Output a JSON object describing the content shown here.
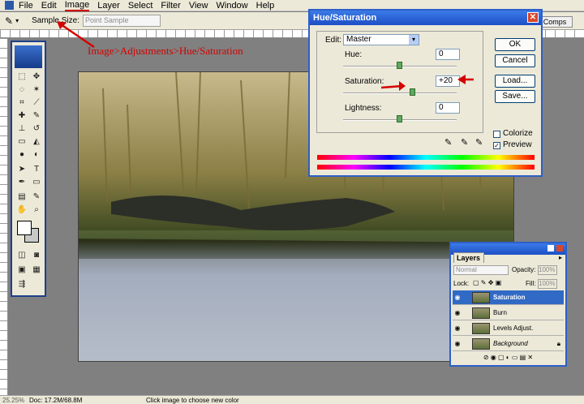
{
  "menubar": {
    "items": [
      "File",
      "Edit",
      "Image",
      "Layer",
      "Select",
      "Filter",
      "View",
      "Window",
      "Help"
    ]
  },
  "options_bar": {
    "sample_size_label": "Sample Size:",
    "sample_size_value": "Point Sample",
    "comps_tab": "Comps"
  },
  "annotation": {
    "text": "Image>Adjustments>Hue/Saturation"
  },
  "hue_saturation": {
    "title": "Hue/Saturation",
    "edit_label": "Edit:",
    "edit_value": "Master",
    "hue_label": "Hue:",
    "hue_value": "0",
    "saturation_label": "Saturation:",
    "saturation_value": "+20",
    "lightness_label": "Lightness:",
    "lightness_value": "0",
    "buttons": {
      "ok": "OK",
      "cancel": "Cancel",
      "load": "Load...",
      "save": "Save..."
    },
    "colorize_label": "Colorize",
    "colorize_checked": false,
    "preview_label": "Preview",
    "preview_checked": true
  },
  "layers": {
    "title": "Layers",
    "blend_mode": "Normal",
    "opacity_label": "Opacity:",
    "opacity_value": "100%",
    "lock_label": "Lock:",
    "fill_label": "Fill:",
    "fill_value": "100%",
    "items": [
      {
        "name": "Saturation",
        "selected": true
      },
      {
        "name": "Burn",
        "selected": false
      },
      {
        "name": "Levels Adjust.",
        "selected": false
      },
      {
        "name": "Background",
        "selected": false
      }
    ]
  },
  "status": {
    "zoom": "25.25%",
    "doc": "Doc: 17.2M/68.8M",
    "hint": "Click image to choose new color"
  },
  "colors": {
    "accent": "#2e5fc8",
    "annotation": "#d40000"
  }
}
